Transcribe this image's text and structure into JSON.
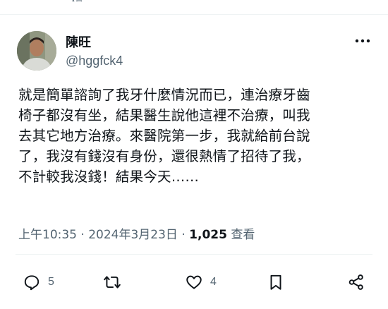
{
  "top_clip_text": "精",
  "author": {
    "name": "陳旺",
    "handle": "@hggfck4"
  },
  "tweet": {
    "text": "就是簡單諮詢了我牙什麼情況而已，連治療牙齒\n椅子都沒有坐，結果醫生說他這裡不治療，叫我\n去其它地方治療。來醫院第一步，我就給前台說\n了，我沒有錢沒有身份，還很熱情了招待了我，\n不計較我沒錢！結果今天……"
  },
  "meta": {
    "time": "上午10:35",
    "sep1": " · ",
    "date": "2024年3月23日",
    "sep2": " · ",
    "views_count": "1,025",
    "views_label": " 查看"
  },
  "actions": {
    "reply_count": "5",
    "retweet_count": "",
    "like_count": "4"
  },
  "colors": {
    "text_primary": "#0f1419",
    "text_secondary": "#536471",
    "divider": "#eff3f4"
  },
  "icons": [
    "more-icon",
    "reply-icon",
    "retweet-icon",
    "like-icon",
    "bookmark-icon",
    "share-icon"
  ]
}
